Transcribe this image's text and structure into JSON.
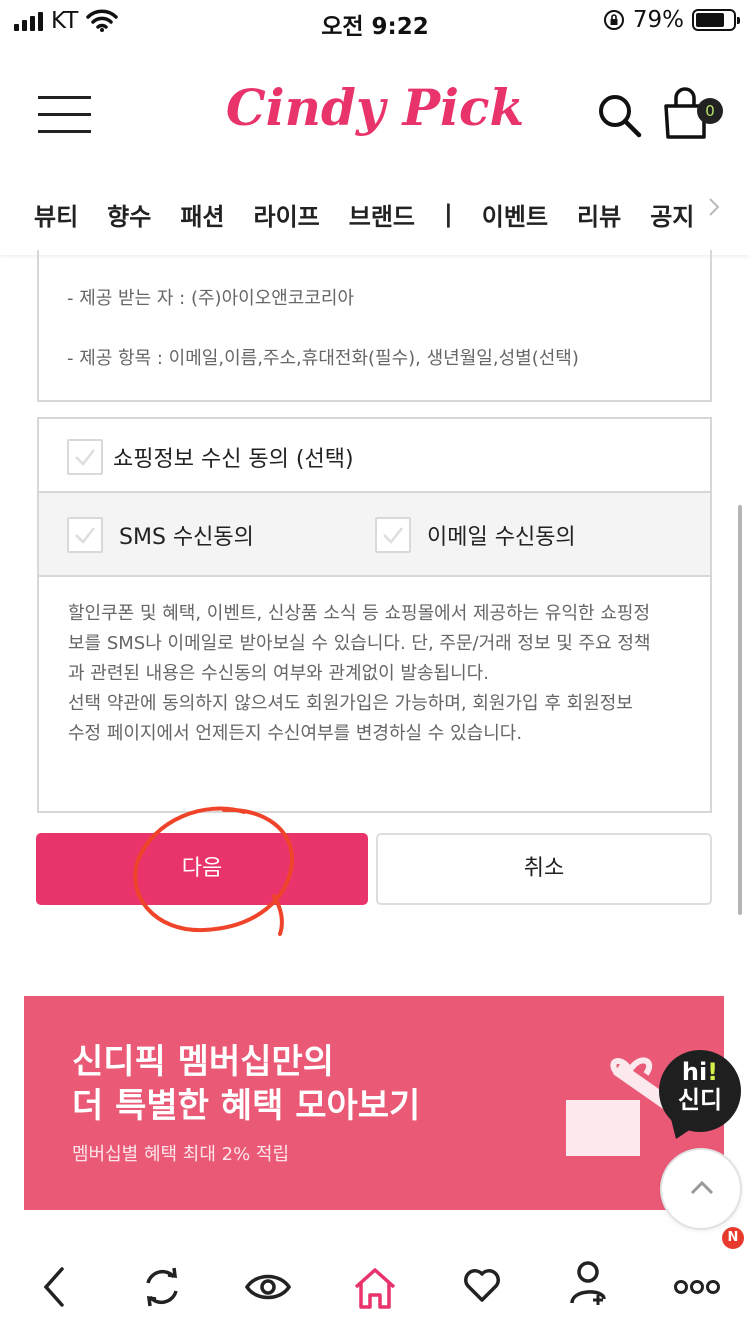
{
  "status_bar": {
    "carrier": "KT",
    "time": "오전 9:22",
    "battery_percent": "79%",
    "battery_level": 0.79
  },
  "header": {
    "logo": "Cindy Pick",
    "cart_count": "0",
    "nav_items": [
      "뷰티",
      "향수",
      "패션",
      "라이프",
      "브랜드"
    ],
    "nav_separator": "|",
    "nav_items_2": [
      "이벤트",
      "리뷰",
      "공지"
    ]
  },
  "terms": {
    "recipient": "- 제공 받는 자 : (주)아이오앤코코리아",
    "items": "- 제공 항목 : 이메일,이름,주소,휴대전화(필수), 생년월일,성별(선택)"
  },
  "consent": {
    "main_label": "쇼핑정보 수신 동의 (선택)",
    "sms_label": "SMS 수신동의",
    "email_label": "이메일 수신동의",
    "description": [
      "할인쿠폰 및 혜택, 이벤트, 신상품 소식 등 쇼핑몰에서 제공하는 유익한 쇼핑정",
      "보를 SMS나 이메일로 받아보실 수 있습니다. 단, 주문/거래 정보 및 주요 정책",
      "과 관련된 내용은 수신동의 여부와 관계없이 발송됩니다.",
      "선택 약관에 동의하지 않으셔도 회원가입은 가능하며, 회원가입 후 회원정보",
      "수정 페이지에서 언제든지 수신여부를 변경하실 수 있습니다."
    ]
  },
  "buttons": {
    "next": "다음",
    "cancel": "취소"
  },
  "banner": {
    "line1": "신디픽 멤버십만의",
    "line2": "더 특별한 혜택 모아보기",
    "sub": "멤버십별 혜택 최대 2% 적립"
  },
  "chat": {
    "hi": "hi",
    "exclaim": "!",
    "name": "신디"
  },
  "tabbar": {
    "badge": "N",
    "icons": [
      "back-icon",
      "refresh-icon",
      "eye-icon",
      "home-icon",
      "heart-icon",
      "add-user-icon",
      "more-icon"
    ]
  },
  "colors": {
    "brand": "#e8336b",
    "banner": "#ea5a76"
  }
}
